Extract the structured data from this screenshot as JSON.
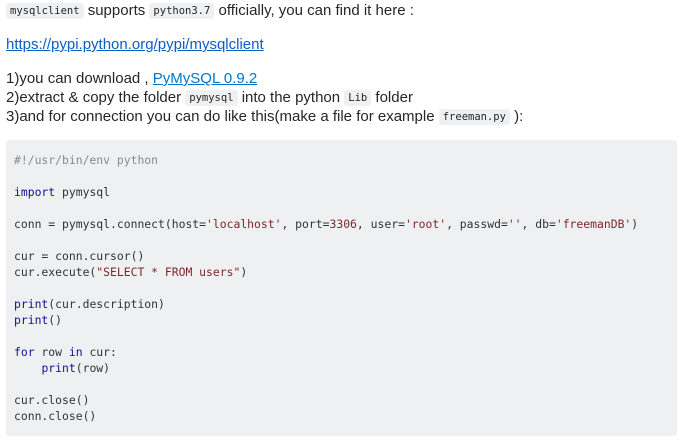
{
  "intro": {
    "code1": "mysqlclient",
    "text1": " supports ",
    "code2": "python3.7",
    "text2": " officially, you can find it here :"
  },
  "link_pypi": "https://pypi.python.org/pypi/mysqlclient",
  "steps": {
    "s1_pre": "1)you can download , ",
    "s1_link": "PyMySQL 0.9.2",
    "s2_pre": "2)extract & copy the folder ",
    "s2_code": "pymysql",
    "s2_mid": " into the python ",
    "s2_code2": "Lib",
    "s2_post": " folder",
    "s3_pre": "3)and for connection you can do like this(make a file for example ",
    "s3_code": "freeman.py",
    "s3_post": " ):"
  },
  "code_lines": [
    [
      {
        "t": "com",
        "v": "#!/usr/bin/env python"
      }
    ],
    [],
    [
      {
        "t": "kw",
        "v": "import"
      },
      {
        "t": "pln",
        "v": " pymysql"
      }
    ],
    [],
    [
      {
        "t": "pln",
        "v": "conn = pymysql.connect(host="
      },
      {
        "t": "str",
        "v": "'localhost'"
      },
      {
        "t": "pln",
        "v": ", port="
      },
      {
        "t": "num",
        "v": "3306"
      },
      {
        "t": "pln",
        "v": ", user="
      },
      {
        "t": "str",
        "v": "'root'"
      },
      {
        "t": "pln",
        "v": ", passwd="
      },
      {
        "t": "str",
        "v": "''"
      },
      {
        "t": "pln",
        "v": ", db="
      },
      {
        "t": "str",
        "v": "'freemanDB'"
      },
      {
        "t": "pln",
        "v": ")"
      }
    ],
    [],
    [
      {
        "t": "pln",
        "v": "cur = conn.cursor()"
      }
    ],
    [
      {
        "t": "pln",
        "v": "cur.execute("
      },
      {
        "t": "str",
        "v": "\"SELECT * FROM users\""
      },
      {
        "t": "pln",
        "v": ")"
      }
    ],
    [],
    [
      {
        "t": "kw",
        "v": "print"
      },
      {
        "t": "pln",
        "v": "(cur.description)"
      }
    ],
    [
      {
        "t": "kw",
        "v": "print"
      },
      {
        "t": "pln",
        "v": "()"
      }
    ],
    [],
    [
      {
        "t": "kw",
        "v": "for"
      },
      {
        "t": "pln",
        "v": " row "
      },
      {
        "t": "kw",
        "v": "in"
      },
      {
        "t": "pln",
        "v": " cur:"
      }
    ],
    [
      {
        "t": "pln",
        "v": "    "
      },
      {
        "t": "kw",
        "v": "print"
      },
      {
        "t": "pln",
        "v": "(row)"
      }
    ],
    [],
    [
      {
        "t": "pln",
        "v": "cur.close()"
      }
    ],
    [
      {
        "t": "pln",
        "v": "conn.close()"
      }
    ]
  ]
}
